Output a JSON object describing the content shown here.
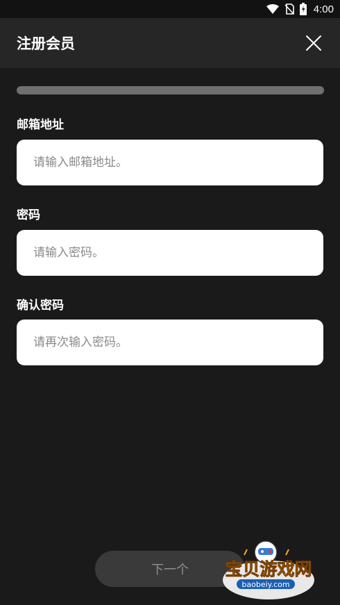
{
  "status_bar": {
    "time": "4:00",
    "icons": [
      "wifi-icon",
      "no-sim-icon",
      "battery-charging-icon"
    ]
  },
  "header": {
    "title": "注册会员",
    "close_icon": "close-icon"
  },
  "progress": {
    "fraction": 0
  },
  "form": {
    "email": {
      "label": "邮箱地址",
      "placeholder": "请输入邮箱地址。",
      "value": ""
    },
    "password": {
      "label": "密码",
      "placeholder": "请输入密码。",
      "value": ""
    },
    "confirm_password": {
      "label": "确认密码",
      "placeholder": "请再次输入密码。",
      "value": ""
    }
  },
  "footer": {
    "next_label": "下一个"
  },
  "watermark": {
    "text": "宝贝游戏网",
    "url": "baobeiy.com"
  },
  "colors": {
    "background": "#1a1a1b",
    "header": "#262627",
    "progress_track": "#6f6f70",
    "button_bg": "#3a3a3b",
    "button_text": "#8f8f8f",
    "watermark_orange": "#f5a623"
  }
}
